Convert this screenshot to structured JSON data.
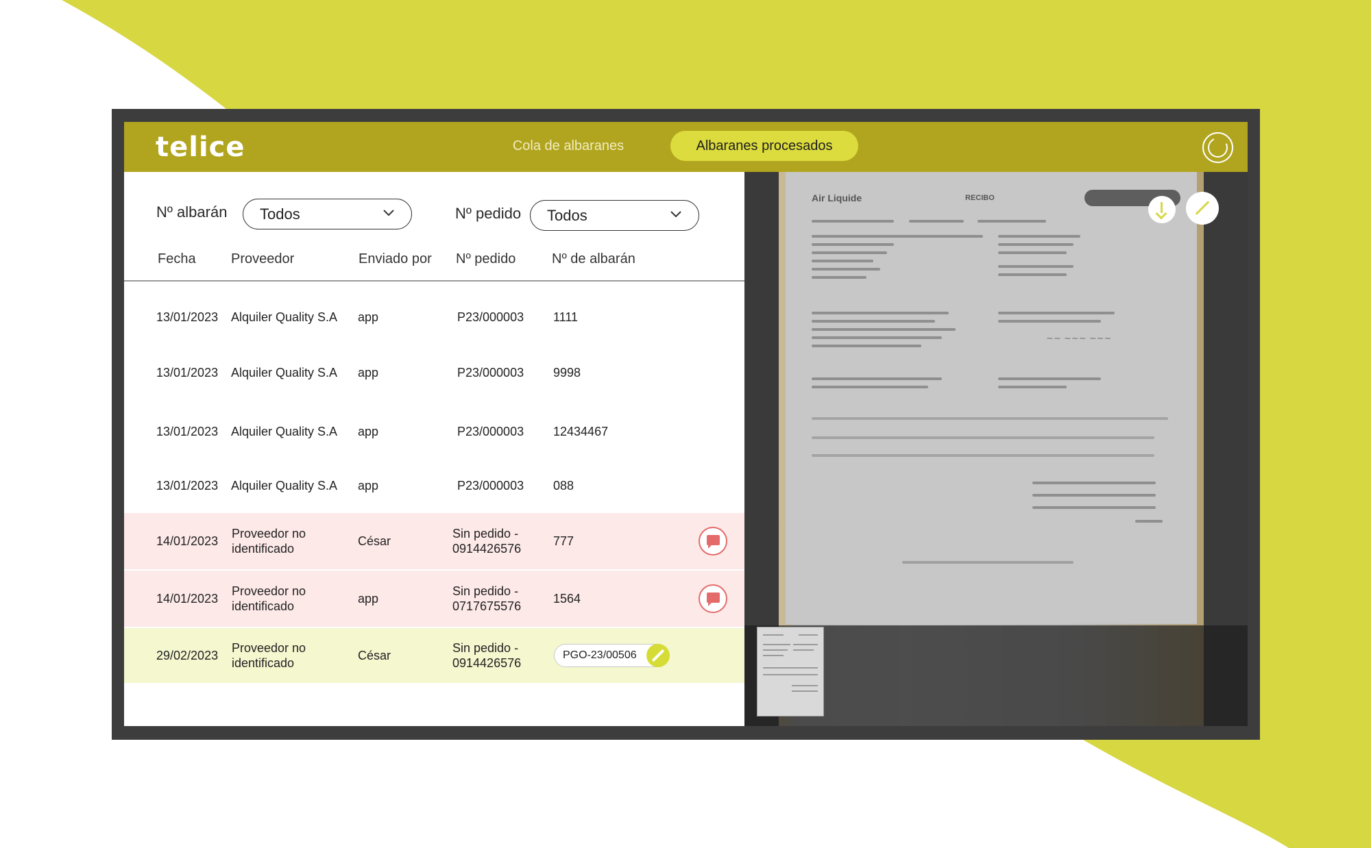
{
  "app": {
    "logo_text": "telice",
    "tabs": [
      {
        "label": "Cola de albaranes",
        "active": false
      },
      {
        "label": "Albaranes procesados",
        "active": true
      }
    ]
  },
  "colors": {
    "brand_yellow": "#d7d742",
    "header_olive": "#b1a51f",
    "active_tab": "#dcdc3e",
    "flagged_row": "#fde9e8",
    "editing_row": "#f5f7cf",
    "alert_red": "#e56b6b"
  },
  "filters": {
    "albaran_label": "Nº albarán",
    "albaran_value": "Todos",
    "pedido_label": "Nº pedido",
    "pedido_value": "Todos"
  },
  "table": {
    "columns": [
      "Fecha",
      "Proveedor",
      "Enviado por",
      "Nº pedido",
      "Nº de albarán"
    ],
    "rows": [
      {
        "fecha": "13/01/2023",
        "proveedor": "Alquiler Quality S.A",
        "enviado": "app",
        "pedido": "P23/000003",
        "albaran": "1111",
        "state": "normal"
      },
      {
        "fecha": "13/01/2023",
        "proveedor": "Alquiler Quality S.A",
        "enviado": "app",
        "pedido": "P23/000003",
        "albaran": "9998",
        "state": "normal"
      },
      {
        "fecha": "13/01/2023",
        "proveedor": "Alquiler Quality S.A",
        "enviado": "app",
        "pedido": "P23/000003",
        "albaran": "12434467",
        "state": "normal"
      },
      {
        "fecha": "13/01/2023",
        "proveedor": "Alquiler Quality S.A",
        "enviado": "app",
        "pedido": "P23/000003",
        "albaran": "088",
        "state": "normal"
      },
      {
        "fecha": "14/01/2023",
        "proveedor_1": "Proveedor no",
        "proveedor_2": "identificado",
        "enviado": "César",
        "pedido_1": "Sin pedido -",
        "pedido_2": "0914426576",
        "albaran": "777",
        "state": "flagged"
      },
      {
        "fecha": "14/01/2023",
        "proveedor_1": "Proveedor no",
        "proveedor_2": "identificado",
        "enviado": "app",
        "pedido_1": "Sin pedido -",
        "pedido_2": "0717675576",
        "albaran": "1564",
        "state": "flagged"
      },
      {
        "fecha": "29/02/2023",
        "proveedor_1": "Proveedor no",
        "proveedor_2": "identificado",
        "enviado": "César",
        "pedido_1": "Sin pedido -",
        "pedido_2": "0914426576",
        "albaran": "PGO-23/00506",
        "state": "editing"
      }
    ]
  },
  "icons": {
    "refresh": "refresh-icon",
    "chevron": "chevron-down-icon",
    "comment": "comment-icon",
    "edit": "pencil-icon",
    "download": "download-icon",
    "expand": "expand-icon"
  },
  "document": {
    "brand": "Air Liquide",
    "title": "RECIBO"
  }
}
